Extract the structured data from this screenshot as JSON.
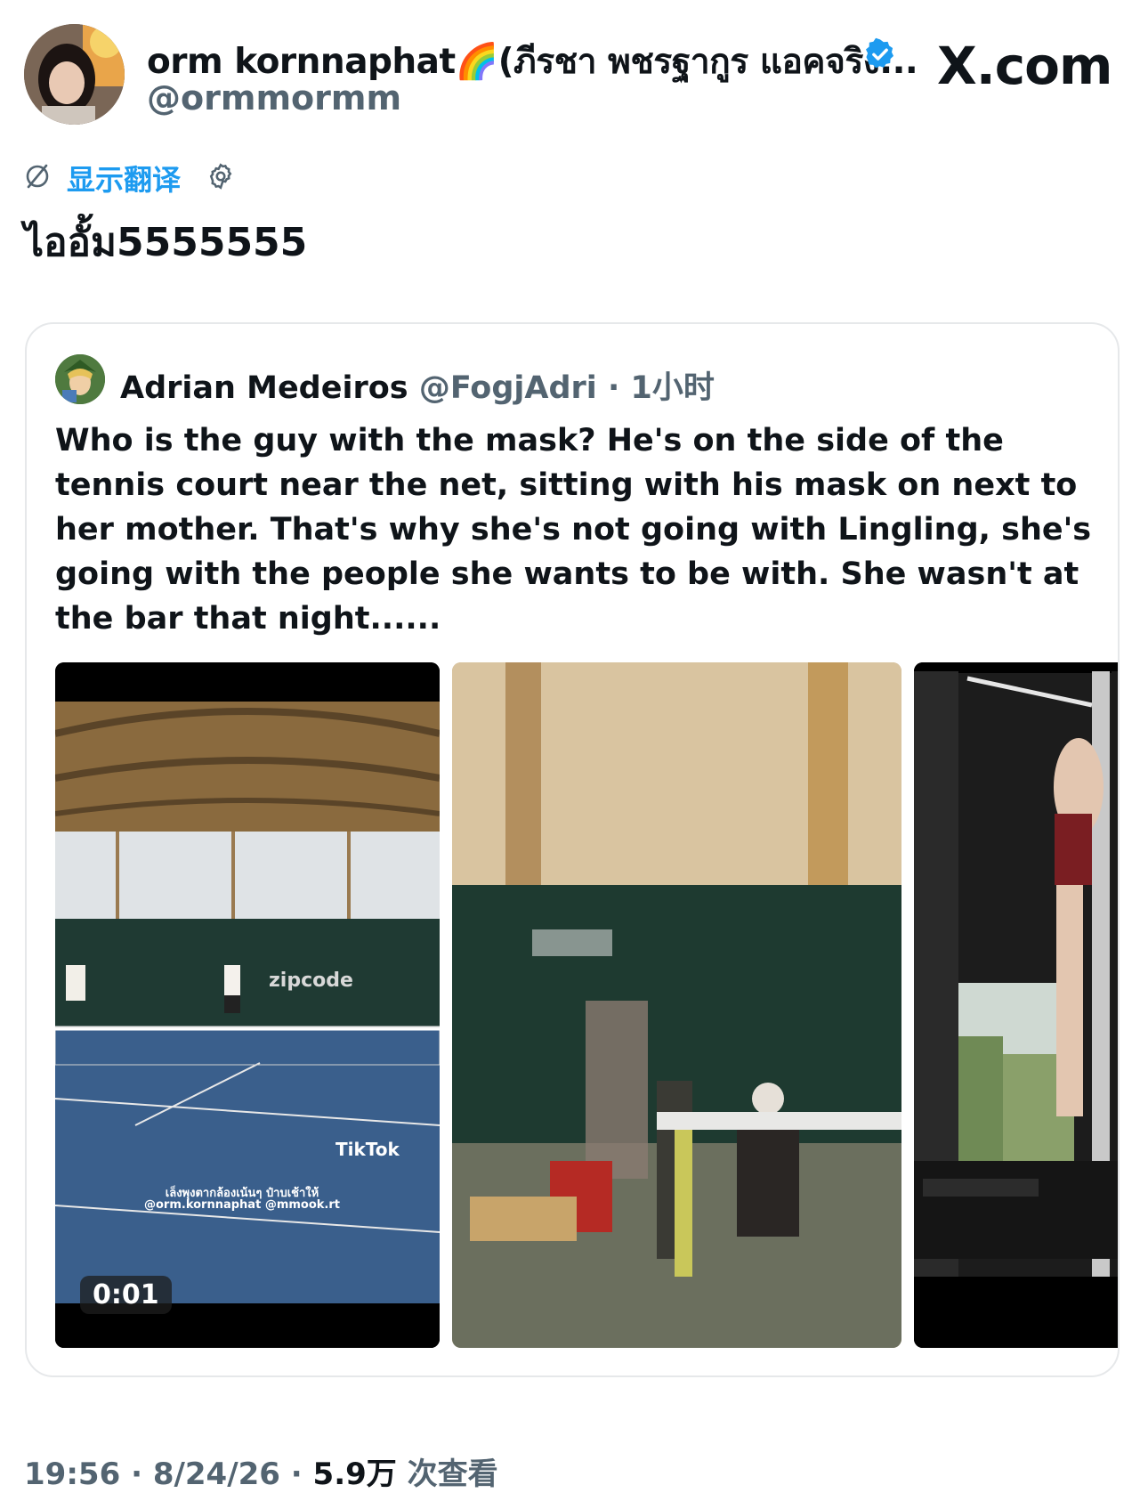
{
  "author": {
    "display_name": "orm kornnaphat🌈(ภีรชา พชรฐากูร แอคจริง...",
    "handle": "@ormmormm",
    "avatar_icon": "profile-avatar",
    "verified_icon": "verified-badge-icon",
    "verified_color": "#1d9bf0"
  },
  "brand": {
    "label": "X.com"
  },
  "translate": {
    "icon": "translate-icon",
    "label": "显示翻译",
    "settings_icon": "gear-icon"
  },
  "post": {
    "text": "ไออั้ม5555555"
  },
  "quote": {
    "display_name": "Adrian Medeiros",
    "handle": "@FogjAdri",
    "separator": "·",
    "time": "1小时",
    "text": "Who is the guy with the mask? He's on the side of the tennis court near the net, sitting with his mask on next to her mother. That's why she's not going with Lingling, she's going with the people she wants to be with. She wasn't at the bar that night......",
    "media": [
      {
        "type": "video",
        "duration": "0:01",
        "overlay_brand": "TikTok",
        "court_sign": "zipcode",
        "caption_line1": "เล็งพุงตากล้องเน้นๆ ป๋าบเช้าให้",
        "caption_line2": "@orm.kornnaphat @mmook.rt"
      },
      {
        "type": "image"
      },
      {
        "type": "image"
      }
    ]
  },
  "footer": {
    "time": "19:56",
    "sep1": " · ",
    "date": "8/24/26",
    "sep2": " · ",
    "views": "5.9万",
    "views_label": " 次查看"
  }
}
